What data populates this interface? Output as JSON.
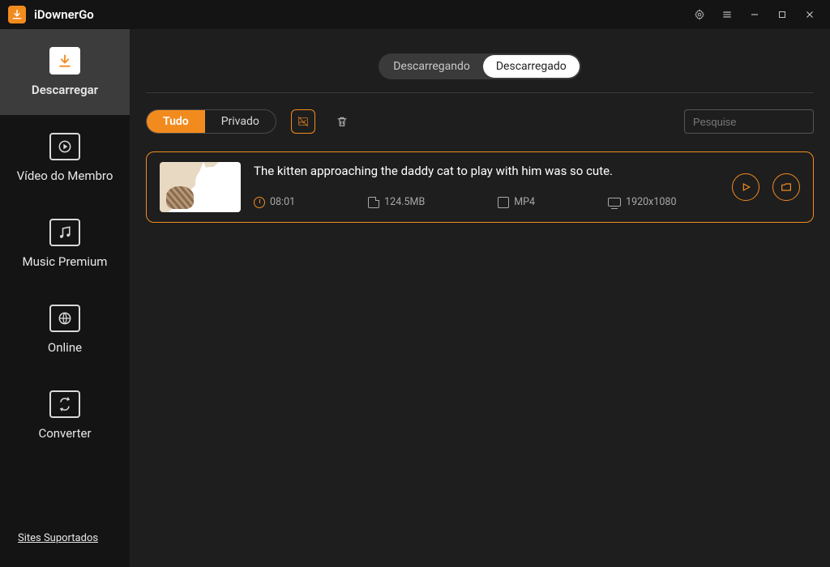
{
  "app": {
    "name": "iDownerGo"
  },
  "sidebar": {
    "items": [
      {
        "label": "Descarregar"
      },
      {
        "label": "Vídeo do Membro"
      },
      {
        "label": "Music Premium"
      },
      {
        "label": "Online"
      },
      {
        "label": "Converter"
      }
    ],
    "bottom_link": "Sites Suportados"
  },
  "tabswitch": {
    "downloading": "Descarregando",
    "downloaded": "Descarregado"
  },
  "filter": {
    "all": "Tudo",
    "private": "Privado"
  },
  "search": {
    "placeholder": "Pesquise"
  },
  "downloads": [
    {
      "title": "The kitten approaching the daddy cat to play with him was so cute.",
      "duration": "08:01",
      "size": "124.5MB",
      "format": "MP4",
      "resolution": "1920x1080"
    }
  ]
}
